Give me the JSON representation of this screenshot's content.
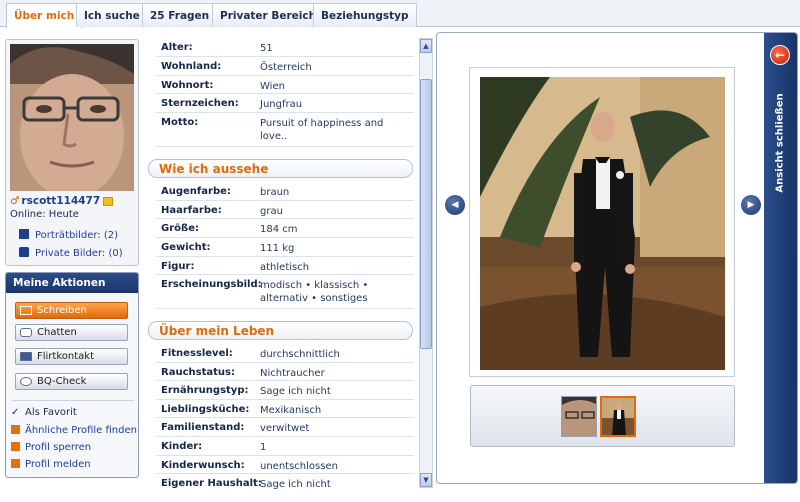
{
  "tabs": [
    "Über mich",
    "Ich suche",
    "25 Fragen",
    "Privater Bereich",
    "Beziehungstyp"
  ],
  "active_tab": "Über mich",
  "profile": {
    "username": "rscott114477",
    "online": "Online: Heute",
    "portrait_pics": "Porträtbilder: (2)",
    "private_pics": "Private Bilder: (0)"
  },
  "actions": {
    "title": "Meine Aktionen",
    "buttons": [
      "Schreiben",
      "Chatten",
      "Flirtkontakt",
      "BQ-Check"
    ],
    "links": [
      "Als Favorit",
      "Ähnliche Profile finden",
      "Profil sperren",
      "Profil melden"
    ]
  },
  "details": {
    "basic": [
      {
        "label": "Alter:",
        "value": "51"
      },
      {
        "label": "Wohnland:",
        "value": "Österreich"
      },
      {
        "label": "Wohnort:",
        "value": "Wien"
      },
      {
        "label": "Sternzeichen:",
        "value": "Jungfrau"
      },
      {
        "label": "Motto:",
        "value": "Pursuit of happiness and love.."
      }
    ],
    "appearance_title": "Wie ich aussehe",
    "appearance": [
      {
        "label": "Augenfarbe:",
        "value": "braun"
      },
      {
        "label": "Haarfarbe:",
        "value": "grau"
      },
      {
        "label": "Größe:",
        "value": "184 cm"
      },
      {
        "label": "Gewicht:",
        "value": "111 kg"
      },
      {
        "label": "Figur:",
        "value": "athletisch"
      },
      {
        "label": "Erscheinungsbild:",
        "value": "modisch • klassisch • alternativ • sonstiges"
      }
    ],
    "life_title": "Über mein Leben",
    "life": [
      {
        "label": "Fitnesslevel:",
        "value": "durchschnittlich"
      },
      {
        "label": "Rauchstatus:",
        "value": "Nichtraucher"
      },
      {
        "label": "Ernährungstyp:",
        "value": "Sage ich nicht"
      },
      {
        "label": "Lieblingsküche:",
        "value": "Mexikanisch"
      },
      {
        "label": "Familienstand:",
        "value": "verwitwet"
      },
      {
        "label": "Kinder:",
        "value": "1"
      },
      {
        "label": "Kinderwunsch:",
        "value": "unentschlossen"
      },
      {
        "label": "Eigener Haushalt:",
        "value": "Sage ich nicht"
      }
    ]
  },
  "viewer": {
    "close_label": "Ansicht schließen"
  },
  "colors": {
    "accent": "#e06a0c",
    "navy": "#1a3569",
    "link": "#1f3f96"
  }
}
